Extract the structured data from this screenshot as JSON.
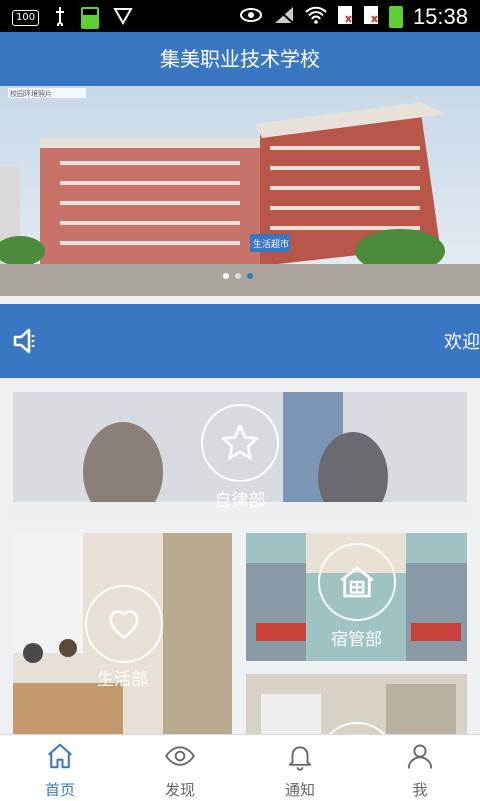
{
  "statusbar": {
    "time": "15:38",
    "badge": "100",
    "battery_text": "100%"
  },
  "header": {
    "title": "集美职业技术学校"
  },
  "banner": {
    "watermark": "校园环境照片",
    "sign_text": "生活超市"
  },
  "notice": {
    "text": "欢迎"
  },
  "cards": [
    {
      "label": "自律部",
      "icon": "star-icon"
    },
    {
      "label": "生活部",
      "icon": "heart-icon"
    },
    {
      "label": "宿管部",
      "icon": "house-icon"
    }
  ],
  "tabs": [
    {
      "label": "首页",
      "icon": "home-icon",
      "active": true
    },
    {
      "label": "发现",
      "icon": "eye-icon",
      "active": false
    },
    {
      "label": "通知",
      "icon": "bell-icon",
      "active": false
    },
    {
      "label": "我",
      "icon": "user-icon",
      "active": false
    }
  ],
  "colors": {
    "primary": "#3a77c3",
    "tab_inactive": "#666666"
  }
}
